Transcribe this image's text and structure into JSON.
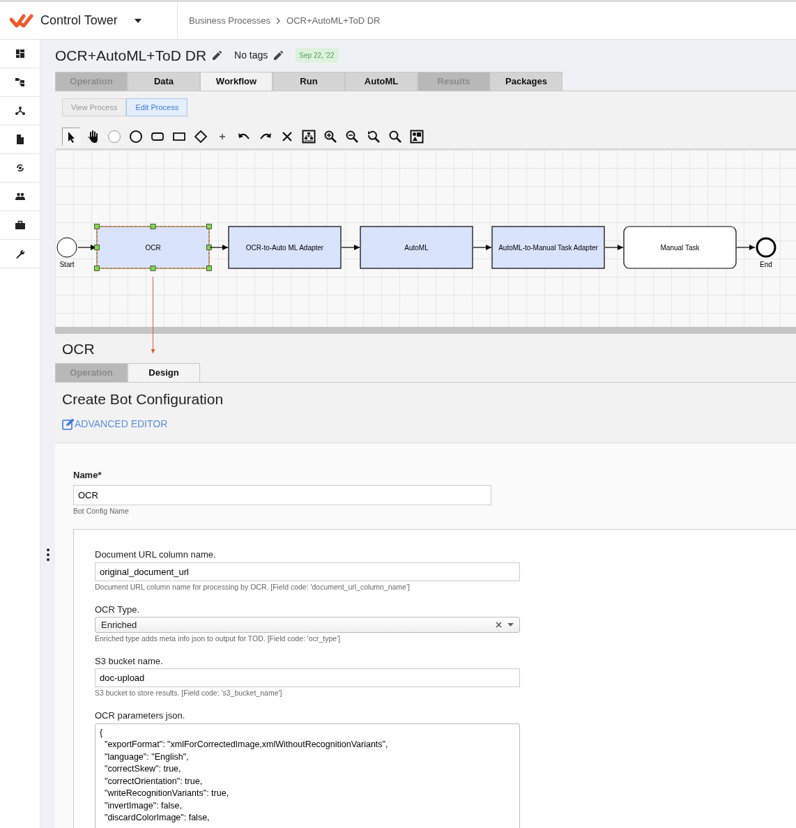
{
  "header": {
    "app_name": "Control Tower",
    "breadcrumb": [
      "Business Processes",
      "OCR+AutoML+ToD DR"
    ]
  },
  "process": {
    "title": "OCR+AutoML+ToD DR",
    "tags": "No tags",
    "date": "Sep 22, '22"
  },
  "tabs": [
    {
      "label": "Operation",
      "selected": false,
      "disabled": true
    },
    {
      "label": "Data",
      "selected": false,
      "disabled": false
    },
    {
      "label": "Workflow",
      "selected": true,
      "disabled": false
    },
    {
      "label": "Run",
      "selected": false,
      "disabled": false
    },
    {
      "label": "AutoML",
      "selected": false,
      "disabled": false
    },
    {
      "label": "Results",
      "selected": false,
      "disabled": true
    },
    {
      "label": "Packages",
      "selected": false,
      "disabled": false
    }
  ],
  "mode_buttons": [
    {
      "label": "View Process",
      "selected": false
    },
    {
      "label": "Edit Process",
      "selected": true
    }
  ],
  "toolbar": {
    "tools": [
      {
        "selected": true
      },
      {
        "selected": false
      },
      {
        "selected": false
      },
      {
        "selected": false
      },
      {
        "selected": false
      },
      {
        "selected": false
      },
      {
        "selected": false
      },
      {
        "selected": false
      },
      {
        "selected": false
      },
      {
        "selected": false
      },
      {
        "selected": false
      },
      {
        "selected": false
      },
      {
        "selected": false
      },
      {
        "selected": false
      },
      {
        "selected": false
      },
      {
        "selected": false
      },
      {
        "selected": false
      }
    ]
  },
  "diagram": {
    "nodes": [
      {
        "kind": "start",
        "label": "Start"
      },
      {
        "kind": "task",
        "label": "OCR",
        "selected": true,
        "color": "#dae3fc"
      },
      {
        "kind": "task",
        "label": "OCR-to-Auto ML Adapter",
        "selected": false,
        "color": "#dae3fc"
      },
      {
        "kind": "task",
        "label": "AutoML",
        "selected": false,
        "color": "#dae3fc"
      },
      {
        "kind": "task",
        "label": "AutoML-to-Manual Task Adapter",
        "selected": false,
        "color": "#dae3fc"
      },
      {
        "kind": "manual",
        "label": "Manual Task",
        "selected": false,
        "color": "#ffffff"
      },
      {
        "kind": "end",
        "label": "End"
      }
    ]
  },
  "panel": {
    "title": "OCR",
    "tabs": [
      {
        "label": "Operation",
        "selected": false,
        "disabled": true
      },
      {
        "label": "Design",
        "selected": true,
        "disabled": false
      }
    ],
    "heading": "Create Bot Configuration",
    "advanced_editor": "ADVANCED EDITOR",
    "name_field": {
      "label": "Name*",
      "value": "OCR",
      "help": "Bot Config Name"
    },
    "fields": [
      {
        "kind": "text",
        "label": "Document URL column name.",
        "value": "original_document_url",
        "help": "Document URL column name for processing by OCR. [Field code: 'document_url_column_name']"
      },
      {
        "kind": "select",
        "label": "OCR Type.",
        "value": "Enriched",
        "help": "Enriched type adds meta info json to output for TOD. [Field code: 'ocr_type']"
      },
      {
        "kind": "text",
        "label": "S3 bucket name.",
        "value": "doc-upload",
        "help": "S3 bucket to store results. [Field code: 's3_bucket_name']"
      },
      {
        "kind": "textarea",
        "label": "OCR parameters json.",
        "lines": [
          "{",
          "  \"exportFormat\": \"xmlForCorrectedImage,xmlWithoutRecognitionVariants\",",
          "  \"language\": \"English\",",
          "  \"correctSkew\": true,",
          "  \"correctOrientation\": true,",
          "  \"writeRecognitionVariants\": true,",
          "  \"invertImage\": false,",
          "  \"discardColorImage\": false,"
        ]
      }
    ]
  }
}
